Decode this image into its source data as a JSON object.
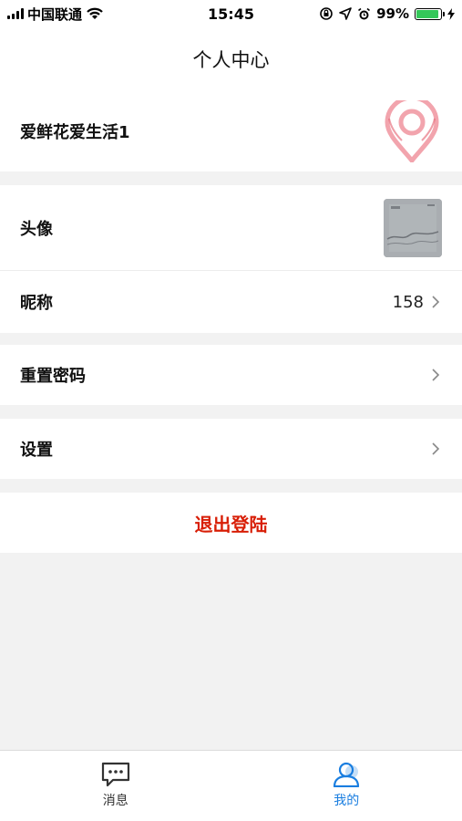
{
  "status_bar": {
    "carrier": "中国联通",
    "time": "15:45",
    "battery": "99%"
  },
  "nav": {
    "title": "个人中心"
  },
  "profile": {
    "username": "爱鲜花爱生活1",
    "logo_icon": "location-pin-logo"
  },
  "rows": {
    "avatar_label": "头像",
    "nickname_label": "昵称",
    "nickname_value": "158",
    "reset_password_label": "重置密码",
    "settings_label": "设置"
  },
  "logout": {
    "label": "退出登陆",
    "color": "#d81e06"
  },
  "tabbar": {
    "messages_label": "消息",
    "mine_label": "我的",
    "active_color": "#1a7ee0"
  }
}
